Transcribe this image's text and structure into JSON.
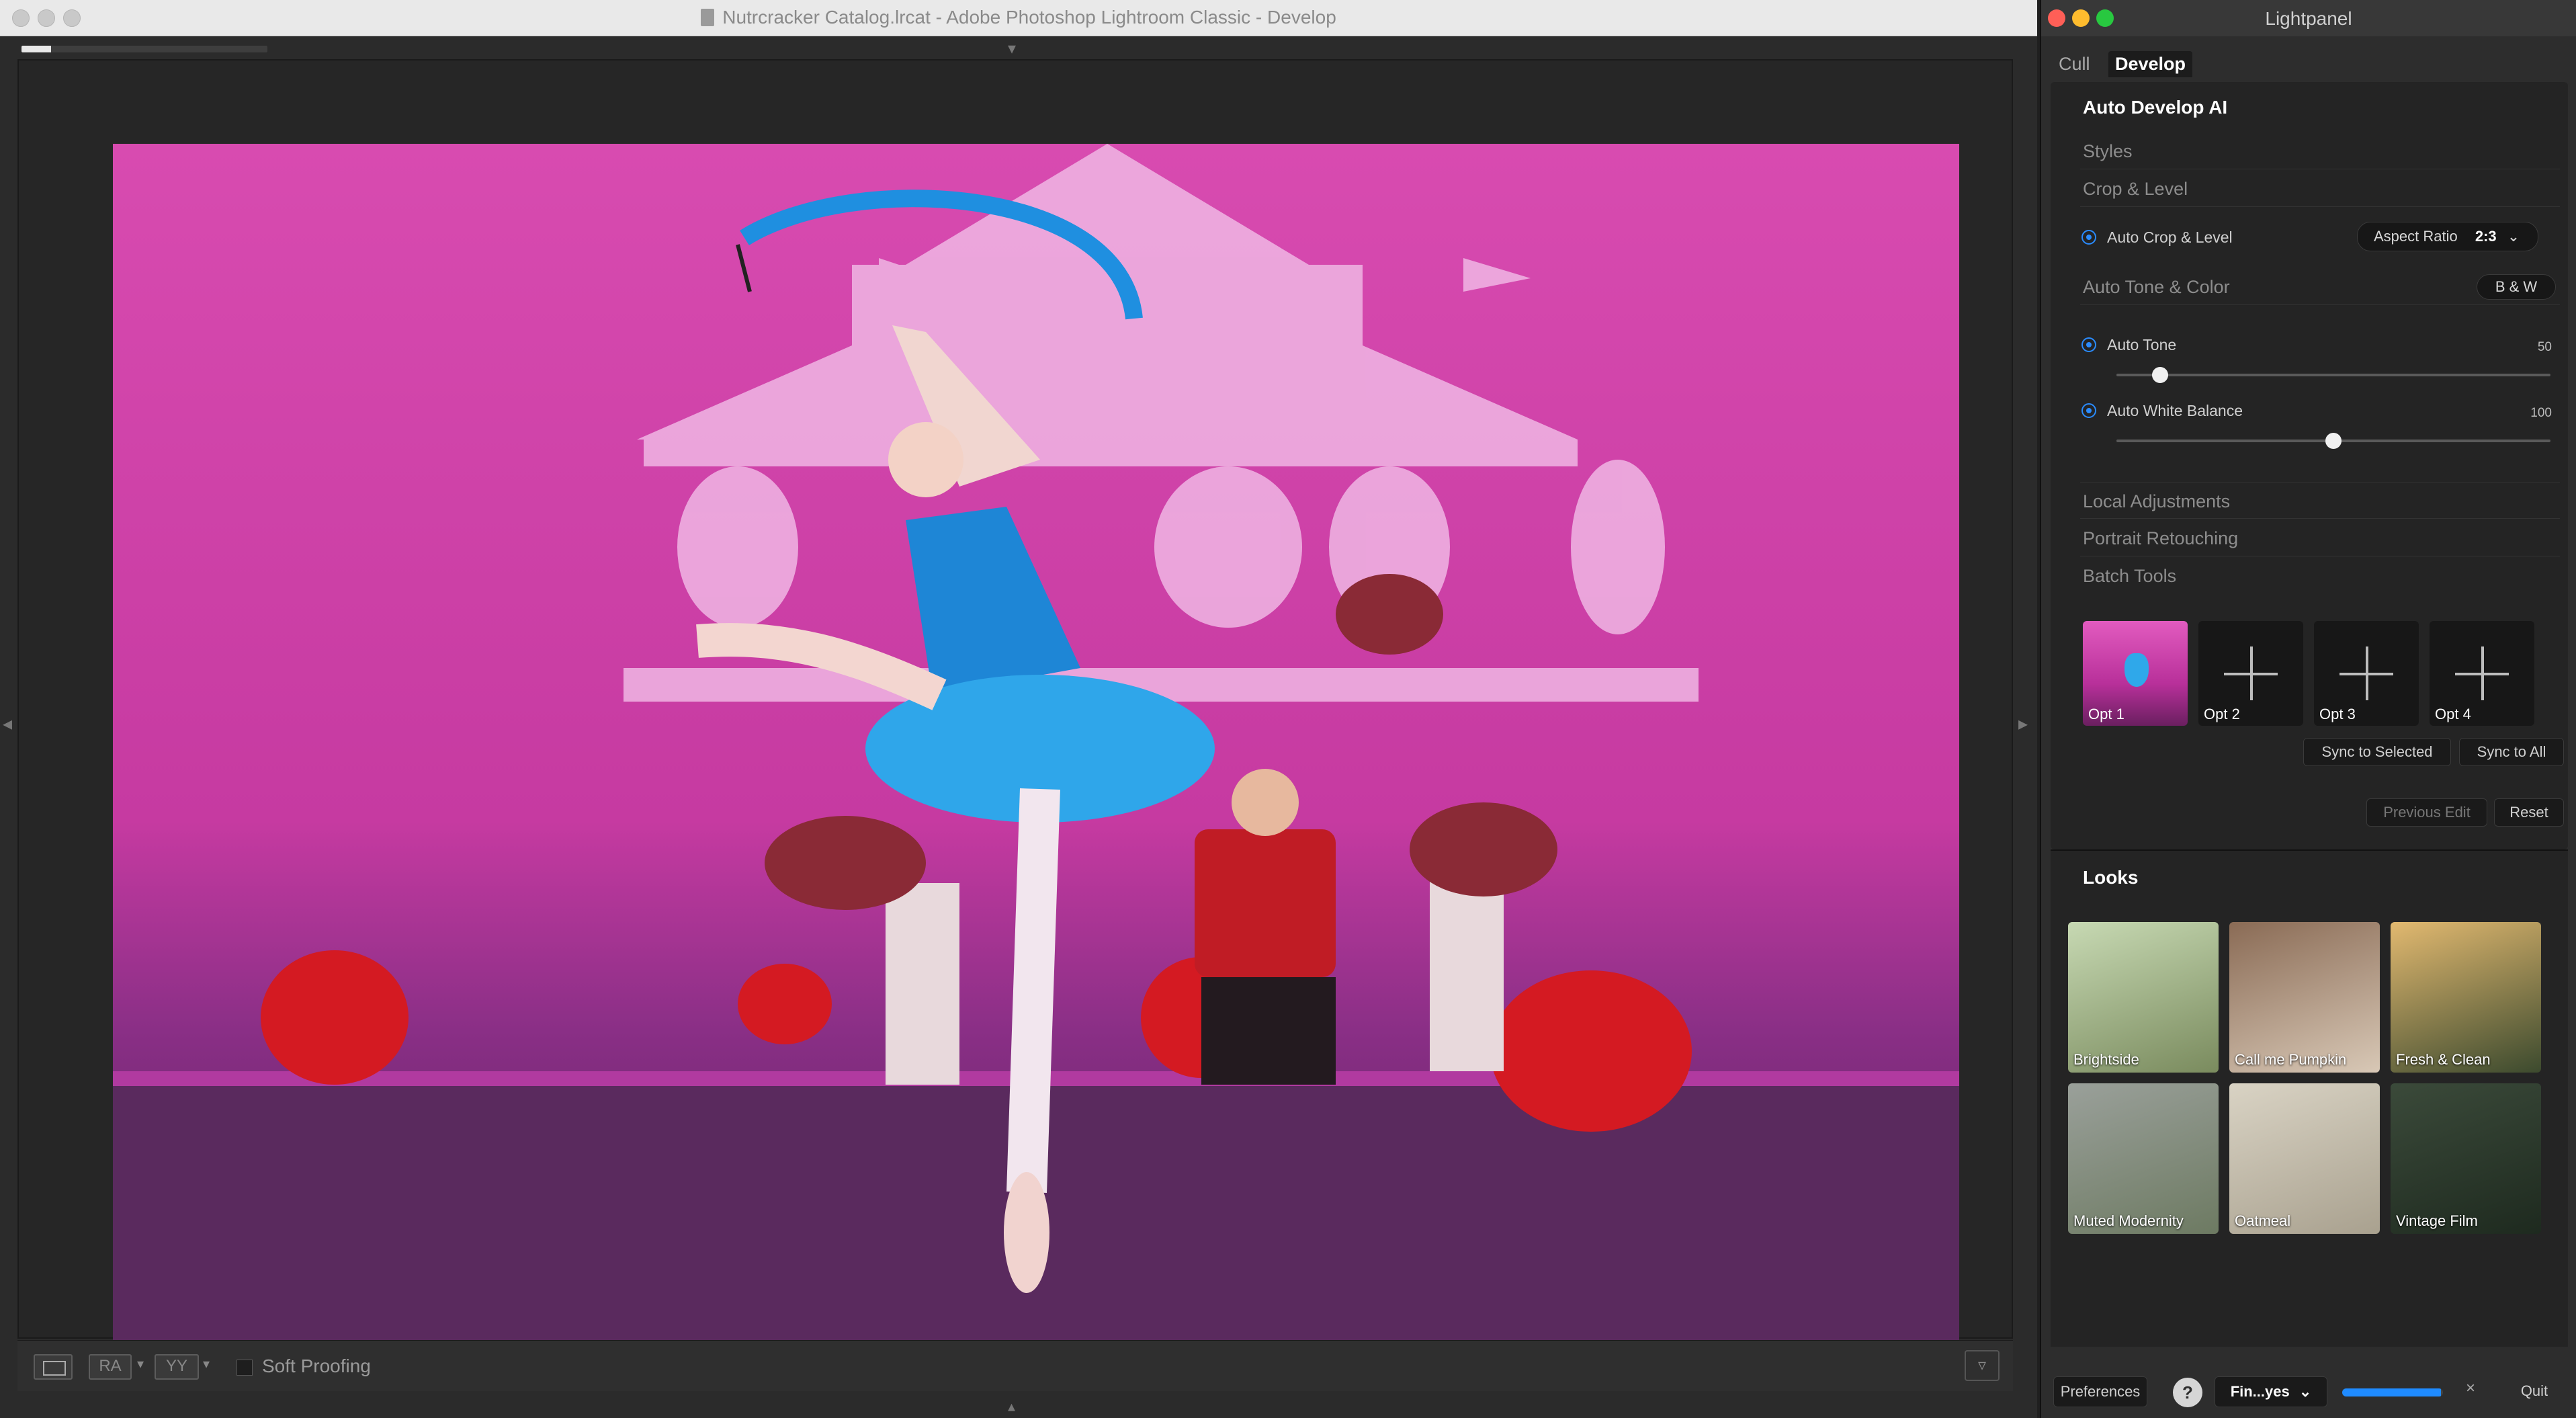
{
  "lightroom": {
    "window_title": "Nutrcracker Catalog.lrcat - Adobe Photoshop Lightroom Classic - Develop",
    "progress_fraction": 0.12,
    "toolbar": {
      "before_after_label": "RA",
      "yy_label": "YY",
      "soft_proofing_label": "Soft Proofing",
      "soft_proofing_checked": false
    }
  },
  "lightpanel": {
    "window_title": "Lightpanel",
    "tabs": [
      {
        "label": "Cull",
        "active": false
      },
      {
        "label": "Develop",
        "active": true
      }
    ],
    "develop": {
      "heading": "Auto Develop AI",
      "sections": {
        "styles": "Styles",
        "crop_level": "Crop & Level",
        "auto_tone_color": "Auto Tone & Color",
        "local_adjustments": "Local Adjustments",
        "portrait_retouching": "Portrait Retouching",
        "batch_tools": "Batch Tools"
      },
      "auto_crop": {
        "label": "Auto Crop & Level",
        "aspect_label": "Aspect Ratio",
        "aspect_value": "2:3"
      },
      "bw_button": "B & W",
      "auto_tone": {
        "label": "Auto Tone",
        "value": "50",
        "fraction": 0.1
      },
      "auto_white_balance": {
        "label": "Auto White Balance",
        "value": "100",
        "fraction": 0.5
      },
      "batch_options": [
        {
          "label": "Opt 1",
          "filled": true
        },
        {
          "label": "Opt 2",
          "filled": false
        },
        {
          "label": "Opt 3",
          "filled": false
        },
        {
          "label": "Opt 4",
          "filled": false
        }
      ],
      "sync_selected": "Sync to Selected",
      "sync_all": "Sync to All",
      "previous_edit": "Previous Edit",
      "reset": "Reset"
    },
    "looks": {
      "heading": "Looks",
      "items": [
        {
          "label": "Brightside",
          "colors": [
            "#c7d9b3",
            "#7a8b5e"
          ]
        },
        {
          "label": "Call me Pumpkin",
          "colors": [
            "#8a6b55",
            "#d8c8b6"
          ]
        },
        {
          "label": "Fresh & Clean",
          "colors": [
            "#e2b970",
            "#3c4a2e"
          ]
        },
        {
          "label": "Muted Modernity",
          "colors": [
            "#9aa09a",
            "#6d7a62"
          ]
        },
        {
          "label": "Oatmeal",
          "colors": [
            "#d9d3c4",
            "#a9a18f"
          ]
        },
        {
          "label": "Vintage Film",
          "colors": [
            "#3b4a3a",
            "#1e2a1f"
          ]
        }
      ]
    },
    "footer": {
      "preferences": "Preferences",
      "help": "?",
      "profile": "Fin...yes",
      "progress_fraction": 0.98,
      "close": "×",
      "quit": "Quit"
    }
  }
}
